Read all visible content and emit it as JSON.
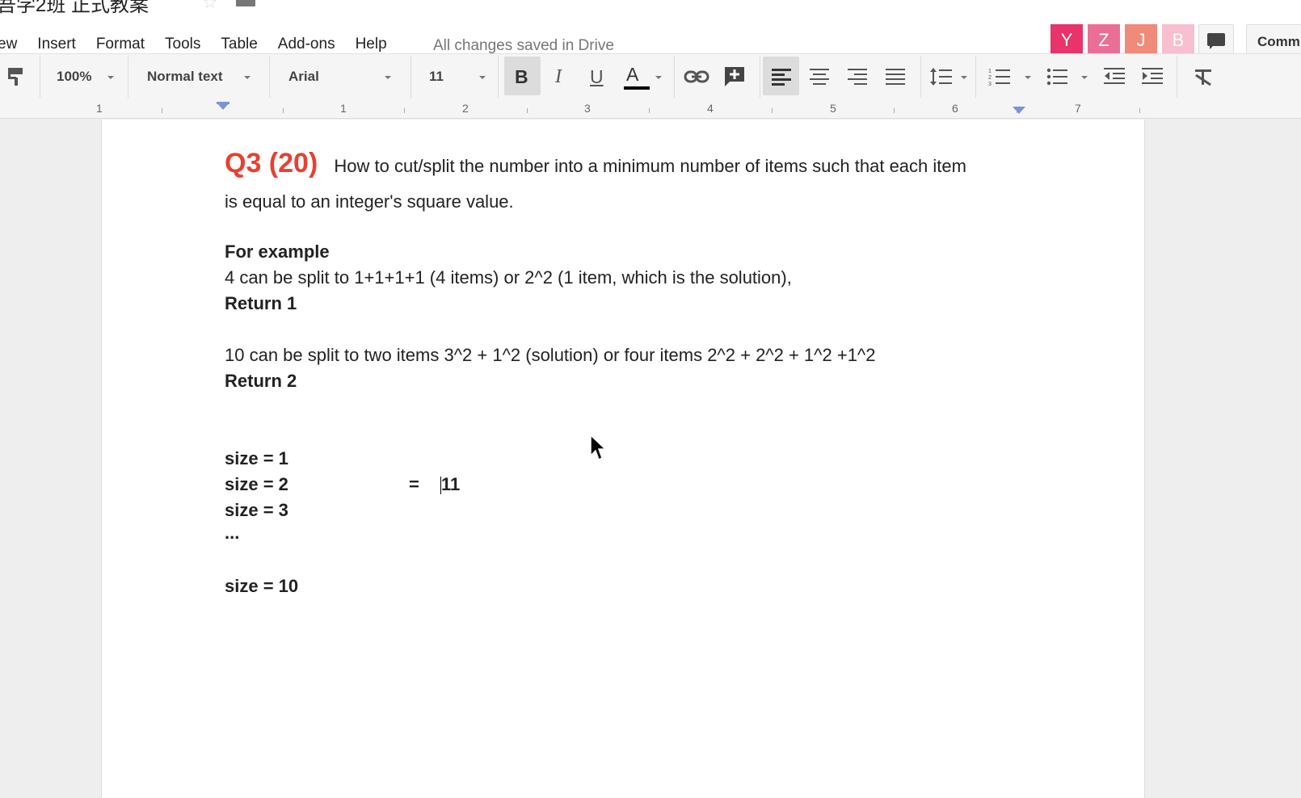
{
  "document": {
    "title": "吾学2班 正式教案"
  },
  "menu": {
    "items": [
      "ew",
      "Insert",
      "Format",
      "Tools",
      "Table",
      "Add-ons",
      "Help"
    ]
  },
  "status": {
    "saved": "All changes saved in Drive"
  },
  "collaborators": [
    {
      "initial": "Y",
      "color": "#e8336b"
    },
    {
      "initial": "Z",
      "color": "#eb6e96"
    },
    {
      "initial": "J",
      "color": "#f08a79"
    },
    {
      "initial": "B",
      "color": "#f7bfcf"
    }
  ],
  "comments": {
    "label": "Comm"
  },
  "toolbar": {
    "zoom": "100%",
    "style": "Normal text",
    "font": "Arial",
    "size": "11",
    "bold": "B",
    "italic": "I",
    "underline": "U",
    "text_color": "A"
  },
  "ruler": {
    "labels": [
      "1",
      "1",
      "2",
      "3",
      "4",
      "5",
      "6",
      "7"
    ]
  },
  "body": {
    "q_label": "Q3 (20)",
    "q_line1": "How to cut/split the number into a minimum number of items such that each item",
    "q_line2": "is equal to an integer's square value.",
    "example_heading": "For example",
    "ex1": "4 can be split to  1+1+1+1 (4 items)   or  2^2 (1 item, which is the solution),",
    "ret1": "Return 1",
    "ex2": "10 can be split to two items   3^2 + 1^2  (solution) or four items   2^2 + 2^2 + 1^2 +1^2",
    "ret2": "Return 2",
    "size1": "size = 1",
    "size2": "size = 2",
    "size2_eq": "=",
    "size2_val": "11",
    "size3": "size = 3",
    "ellipsis": "...",
    "size10": "size = 10"
  }
}
